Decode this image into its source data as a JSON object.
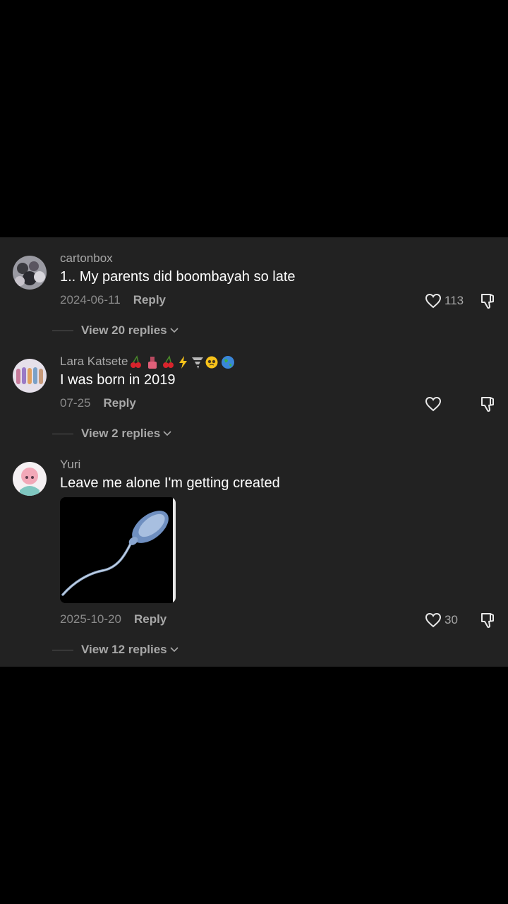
{
  "comments": [
    {
      "username": "cartonbox",
      "text": "1.. My parents did boombayah so late",
      "date": "2024-06-11",
      "reply_label": "Reply",
      "likes": "113",
      "view_replies": "View 20 replies"
    },
    {
      "username": "Lara Katsete",
      "username_emojis": [
        "cherries-icon",
        "nail-polish-icon",
        "cherries-icon",
        "lightning-icon",
        "tornado-icon",
        "pleading-face-icon",
        "earth-globe-icon"
      ],
      "text": "I was born in 2019",
      "date": "07-25",
      "reply_label": "Reply",
      "likes": "",
      "view_replies": "View 2 replies"
    },
    {
      "username": "Yuri",
      "text": "Leave me alone I'm getting created",
      "attachment": "sperm-cell-image",
      "date": "2025-10-20",
      "reply_label": "Reply",
      "likes": "30",
      "view_replies": "View 12 replies"
    }
  ],
  "colors": {
    "background": "#000000",
    "panel": "#222222",
    "text_primary": "#ffffff",
    "text_secondary": "#a8a8a8",
    "date": "#8a8a8a"
  }
}
